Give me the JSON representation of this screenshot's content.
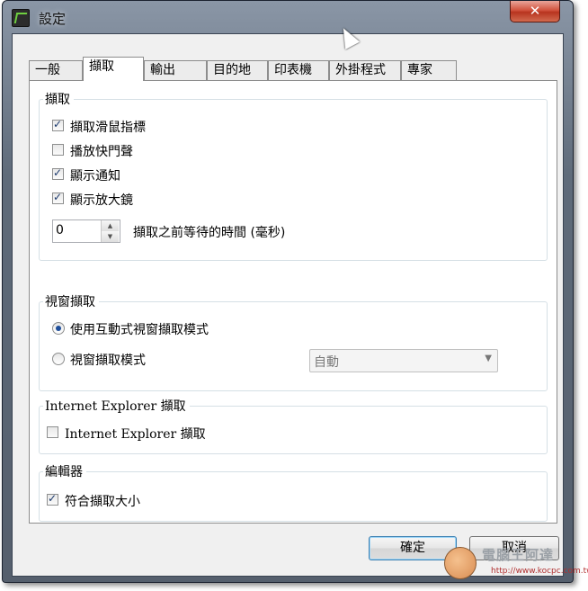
{
  "window": {
    "title": "設定",
    "close_glyph": "✕"
  },
  "tabs": [
    {
      "label": "一般",
      "active": false
    },
    {
      "label": "擷取",
      "active": true
    },
    {
      "label": "輸出",
      "active": false
    },
    {
      "label": "目的地",
      "active": false
    },
    {
      "label": "印表機",
      "active": false
    },
    {
      "label": "外掛程式",
      "active": false
    },
    {
      "label": "專家",
      "active": false
    }
  ],
  "capture_group": {
    "title": "擷取",
    "options": [
      {
        "label": "擷取滑鼠指標",
        "checked": true
      },
      {
        "label": "播放快門聲",
        "checked": false
      },
      {
        "label": "顯示通知",
        "checked": true
      },
      {
        "label": "顯示放大鏡",
        "checked": true
      }
    ],
    "delay": {
      "value": "0",
      "label": "擷取之前等待的時間 (毫秒)"
    }
  },
  "window_capture_group": {
    "title": "視窗擷取",
    "radio_interactive": {
      "label": "使用互動式視窗擷取模式",
      "selected": true
    },
    "radio_mode": {
      "label": "視窗擷取模式",
      "selected": false
    },
    "mode_select": {
      "value": "自動",
      "enabled": false
    }
  },
  "ie_group": {
    "title": "Internet Explorer 擷取",
    "option": {
      "label": "Internet Explorer 擷取",
      "checked": false
    }
  },
  "editor_group": {
    "title": "編輯器",
    "option": {
      "label": "符合擷取大小",
      "checked": true
    }
  },
  "buttons": {
    "ok": "確定",
    "cancel": "取消"
  },
  "watermark": {
    "text": "電腦王阿達",
    "url": "http://www.kocpc.com.tw"
  },
  "colors": {
    "accent": "#1f4e9a",
    "frame": "#5f6b7a",
    "close": "#d2533e"
  }
}
